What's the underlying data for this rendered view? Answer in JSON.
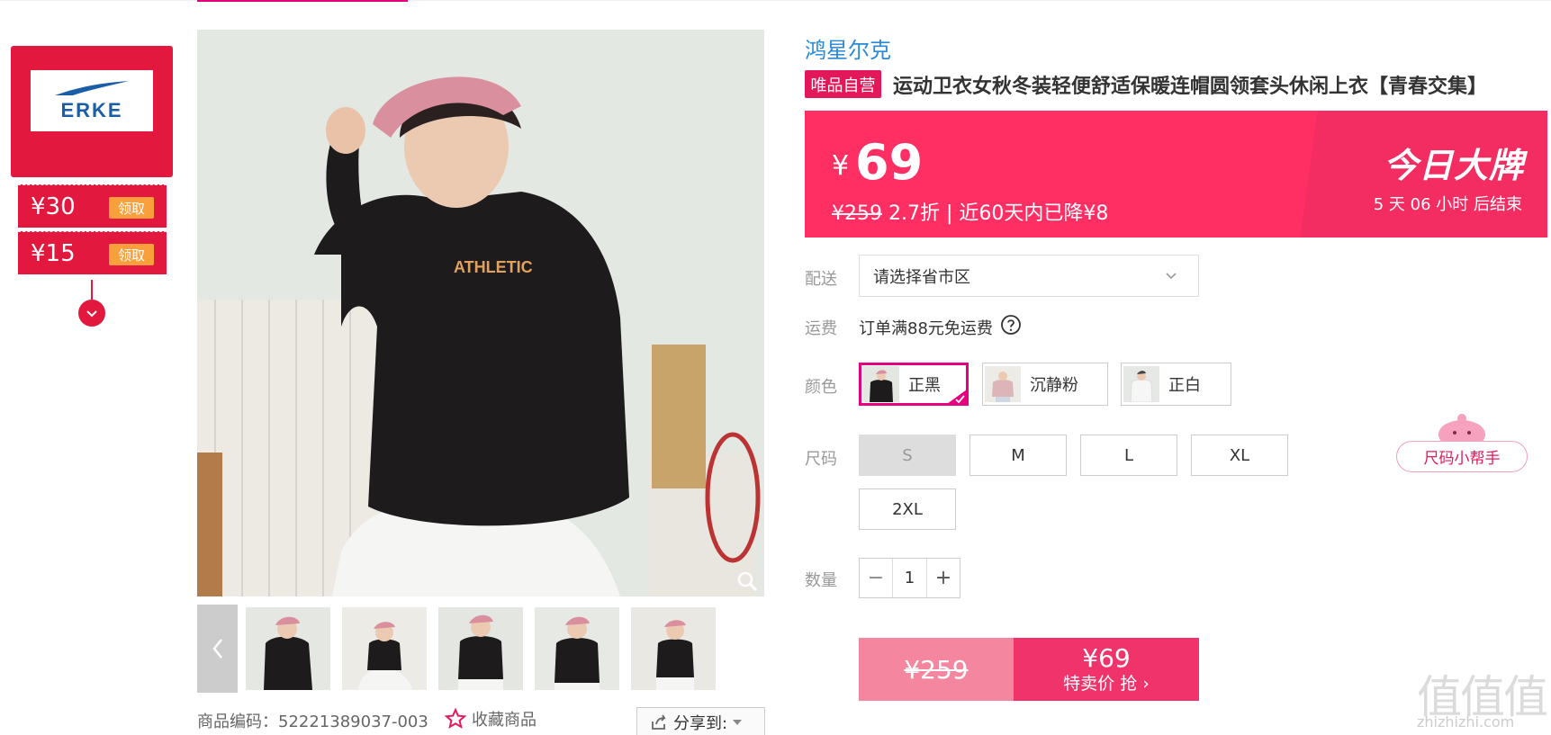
{
  "colors": {
    "accent": "#e4007f",
    "coupon_red": "#e2183e",
    "price_banner": "#ff2f64",
    "link_blue": "#2a8ad8",
    "buy_now": "#f0336a",
    "buy_orig": "#f4879f"
  },
  "brand_panel": {
    "logo_text": "ERKE",
    "coupons": [
      {
        "amount": "¥30",
        "action": "领取"
      },
      {
        "amount": "¥15",
        "action": "领取"
      }
    ],
    "toggle_icon": "chevron-down-icon"
  },
  "gallery": {
    "main_photo_text": "ATHLETIC",
    "zoom_icon": "magnifier-icon",
    "thumbnails": [
      "thumb-1",
      "thumb-2",
      "thumb-3",
      "thumb-4",
      "thumb-5"
    ],
    "prev_icon": "chevron-left-icon",
    "next_icon": "chevron-right-icon"
  },
  "product_meta": {
    "code_label": "商品编码：",
    "code_value": "52221389037-003",
    "favorite_label": "收藏商品",
    "share_label": "分享到:"
  },
  "product": {
    "brand": "鸿星尔克",
    "tag": "唯品自营",
    "title": "运动卫衣女秋冬装轻便舒适保暖连帽圆领套头休闲上衣【青春交集】"
  },
  "price": {
    "currency": "¥",
    "current": "69",
    "original": "¥259",
    "discount": "2.7折 | 近60天内已降¥8",
    "event": "今日大牌",
    "countdown": "5  天 06 小时 后结束"
  },
  "shipping": {
    "delivery_label": "配送",
    "delivery_placeholder": "请选择省市区",
    "fee_label": "运费",
    "fee_text": "订单满88元免运费"
  },
  "color": {
    "label": "颜色",
    "options": [
      {
        "name": "正黑",
        "selected": true
      },
      {
        "name": "沉静粉",
        "selected": false
      },
      {
        "name": "正白",
        "selected": false
      }
    ]
  },
  "size": {
    "label": "尺码",
    "options": [
      {
        "name": "S",
        "available": false
      },
      {
        "name": "M",
        "available": true
      },
      {
        "name": "L",
        "available": true
      },
      {
        "name": "XL",
        "available": true
      },
      {
        "name": "2XL",
        "available": true
      }
    ],
    "helper_label": "尺码小帮手"
  },
  "quantity": {
    "label": "数量",
    "value": "1",
    "minus": "−",
    "plus": "+"
  },
  "buy_button": {
    "original_price": "¥259",
    "sale_price": "¥69",
    "action": "特卖价 抢 ›"
  },
  "watermark": {
    "mark": "值值值",
    "domain": "zhizhizhi.com"
  }
}
